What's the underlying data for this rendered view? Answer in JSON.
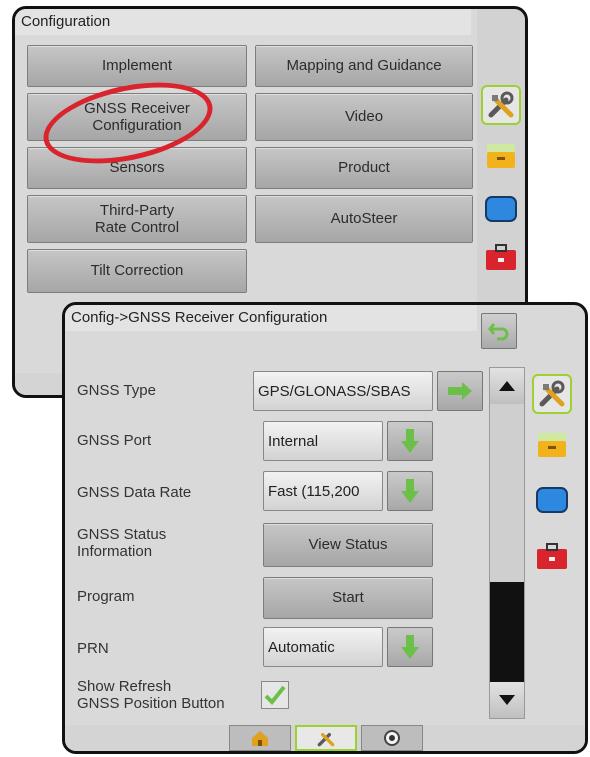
{
  "back_panel": {
    "title": "Configuration",
    "buttons": [
      {
        "label": "Implement"
      },
      {
        "label": "Mapping and Guidance"
      },
      {
        "label": "GNSS Receiver\nConfiguration"
      },
      {
        "label": "Video"
      },
      {
        "label": "Sensors"
      },
      {
        "label": "Product"
      },
      {
        "label": "Third-Party\nRate Control"
      },
      {
        "label": "AutoSteer"
      },
      {
        "label": "Tilt Correction"
      }
    ]
  },
  "front_panel": {
    "breadcrumb": "Config->GNSS Receiver Configuration",
    "rows": [
      {
        "label": "GNSS Type",
        "value": "GPS/GLONASS/SBAS"
      },
      {
        "label": "GNSS Port",
        "value": "Internal"
      },
      {
        "label": "GNSS Data Rate",
        "value": "Fast (115,200"
      },
      {
        "label": "GNSS Status\nInformation",
        "value": "View Status"
      },
      {
        "label": "Program",
        "value": "Start"
      },
      {
        "label": "PRN",
        "value": "Automatic"
      },
      {
        "label": "Show Refresh\nGNSS Position Button",
        "checked": true
      }
    ]
  },
  "sidebar_icons": [
    "tools-icon",
    "tray-icon",
    "screen-icon",
    "toolkit-icon"
  ],
  "bottom_tabs": [
    "home-icon",
    "tools-icon",
    "camera-icon"
  ],
  "colors": {
    "accent_green": "#9fd033",
    "highlight_red": "#d9232d",
    "arrow_green": "#6cc04a"
  }
}
